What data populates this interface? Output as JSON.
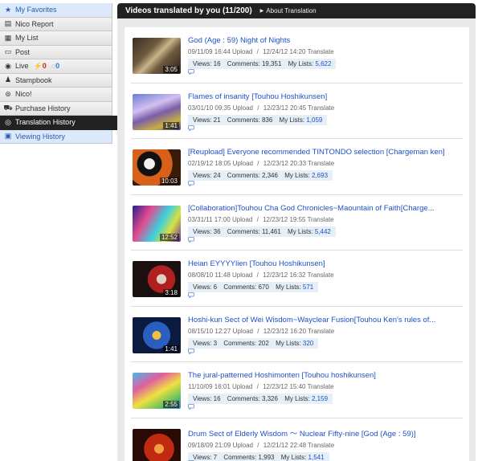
{
  "sidebar": {
    "items": [
      {
        "label": "My Favorites",
        "icon": "star-icon"
      },
      {
        "label": "Nico Report",
        "icon": "report-icon"
      },
      {
        "label": "My List",
        "icon": "list-icon"
      },
      {
        "label": "Post",
        "icon": "post-icon"
      },
      {
        "label": "Live",
        "icon": "live-icon"
      },
      {
        "label": "Stampbook",
        "icon": "stamp-icon"
      },
      {
        "label": "Nico!",
        "icon": "nico-icon"
      },
      {
        "label": "Purchase History",
        "icon": "cart-icon"
      },
      {
        "label": "Translation History",
        "icon": "translation-icon"
      },
      {
        "label": "Viewing History",
        "icon": "video-icon"
      }
    ],
    "live_badges": {
      "alert_count": "0",
      "comment_count": "0"
    }
  },
  "main": {
    "title": "Videos translated by you (11/200)",
    "about_link": "About Translation"
  },
  "videos": [
    {
      "title": "God (Age : 59) Night of Nights",
      "posted": "09/11/09 16:44",
      "upload_label": "Upload",
      "translated": "12/24/12 14:20",
      "translate_label": "Translate",
      "duration": "3:05",
      "views_label": "Views:",
      "views": "16",
      "comments_label": "Comments:",
      "comments": "19,351",
      "mylists_label": "My Lists:",
      "mylists": "5,622"
    },
    {
      "title": "Flames of insanity [Touhou Hoshikunsen]",
      "posted": "03/01/10 09:35",
      "upload_label": "Upload",
      "translated": "12/23/12 20:45",
      "translate_label": "Translate",
      "duration": "1:41",
      "views_label": "Views:",
      "views": "21",
      "comments_label": "Comments:",
      "comments": "836",
      "mylists_label": "My Lists:",
      "mylists": "1,059"
    },
    {
      "title": "[Reupload] Everyone recommended TINTONDO selection [Chargeman ken]",
      "posted": "02/19/12 18:05",
      "upload_label": "Upload",
      "translated": "12/23/12 20:33",
      "translate_label": "Translate",
      "duration": "10:03",
      "views_label": "Views:",
      "views": "24",
      "comments_label": "Comments:",
      "comments": "2,346",
      "mylists_label": "My Lists:",
      "mylists": "2,693"
    },
    {
      "title": "[Collaboration]Touhou Cha God Chronicles~Maountain of Faith[Charge...",
      "posted": "03/31/11 17:00",
      "upload_label": "Upload",
      "translated": "12/23/12 19:55",
      "translate_label": "Translate",
      "duration": "12:52",
      "views_label": "Views:",
      "views": "36",
      "comments_label": "Comments:",
      "comments": "11,461",
      "mylists_label": "My Lists:",
      "mylists": "5,442"
    },
    {
      "title": "Heian EYYYYlien [Touhou Hoshikunsen]",
      "posted": "08/08/10 11:48",
      "upload_label": "Upload",
      "translated": "12/23/12 16:32",
      "translate_label": "Translate",
      "duration": "3:18",
      "views_label": "Views:",
      "views": "6",
      "comments_label": "Comments:",
      "comments": "670",
      "mylists_label": "My Lists:",
      "mylists": "571"
    },
    {
      "title": "Hoshi-kun Sect of Wei Wisdom~Waycl​ear Fusion[Touhou Ken's rules of...",
      "posted": "08/15/10 12:27",
      "upload_label": "Upload",
      "translated": "12/23/12 16:20",
      "translate_label": "Translate",
      "duration": "1:41",
      "views_label": "Views:",
      "views": "3",
      "comments_label": "Comments:",
      "comments": "202",
      "mylists_label": "My Lists:",
      "mylists": "320"
    },
    {
      "title": "The jural-patterned Hoshimonten [Touhou hoshikunsen]",
      "posted": "11/10/09 16:01",
      "upload_label": "Upload",
      "translated": "12/23/12 15:40",
      "translate_label": "Translate",
      "duration": "2:55",
      "views_label": "Views:",
      "views": "16",
      "comments_label": "Comments:",
      "comments": "3,326",
      "mylists_label": "My Lists:",
      "mylists": "2,159"
    },
    {
      "title": "Drum Sect of Elderly Wisdom 〜 Nuclear Fifty-nine [God (Age : 59)]",
      "posted": "09/18/09 21:09",
      "upload_label": "Upload",
      "translated": "12/21/12 22:48",
      "translate_label": "Translate",
      "duration": "",
      "views_label": "Views:",
      "views": "7",
      "comments_label": "Comments:",
      "comments": "1,993",
      "mylists_label": "My Lists:",
      "mylists": "1,541"
    }
  ],
  "colors": {
    "accent_blue": "#1c50c8",
    "header_black": "#222222",
    "stats_bg": "#e6eef8"
  }
}
